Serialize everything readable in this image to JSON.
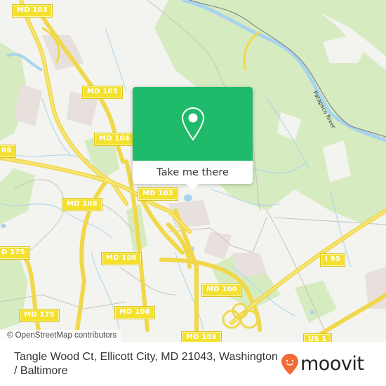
{
  "map": {
    "road_labels": [
      {
        "id": "md103-nw",
        "text": "MD 103"
      },
      {
        "id": "md103-n",
        "text": "MD 103"
      },
      {
        "id": "md104",
        "text": "MD 104"
      },
      {
        "id": "md108-w",
        "text": "08"
      },
      {
        "id": "md108-c",
        "text": "MD 108"
      },
      {
        "id": "md103-c",
        "text": "MD 103"
      },
      {
        "id": "md175-w",
        "text": "D 175"
      },
      {
        "id": "md108-s1",
        "text": "MD 108"
      },
      {
        "id": "md100",
        "text": "MD 100"
      },
      {
        "id": "i95",
        "text": "I 95"
      },
      {
        "id": "md175-s",
        "text": "MD 175"
      },
      {
        "id": "md108-s2",
        "text": "MD 108"
      },
      {
        "id": "md103-s",
        "text": "MD 103"
      },
      {
        "id": "us1",
        "text": "US 1"
      }
    ],
    "water_label": "Patapsco River",
    "attribution": "© OpenStreetMap contributors"
  },
  "popup": {
    "icon": "map-pin-icon",
    "button_label": "Take me there",
    "accent_color": "#1fba6a"
  },
  "footer": {
    "address": "Tangle Wood Ct, Ellicott City, MD 21043, Washington / Baltimore",
    "logo_text": "moovit",
    "logo_color": "#f26a36"
  }
}
